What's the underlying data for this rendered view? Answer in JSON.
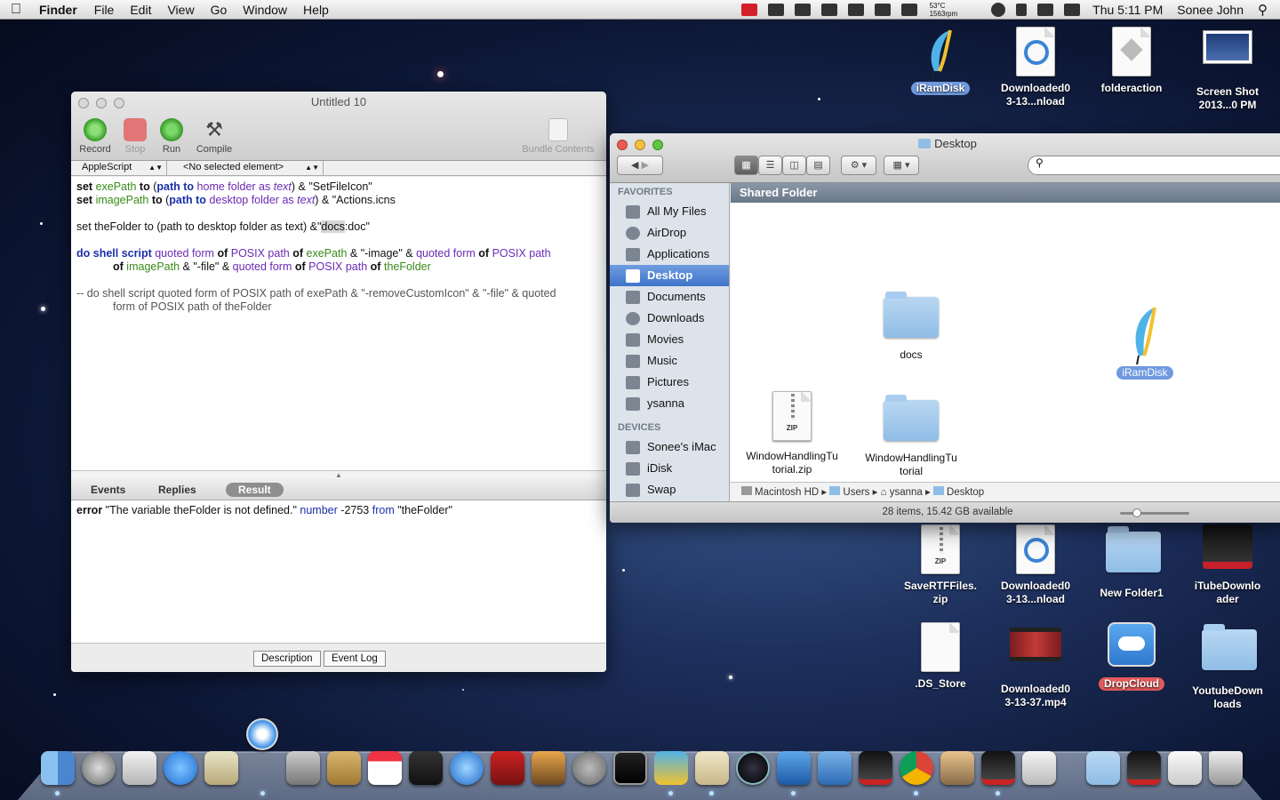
{
  "menubar": {
    "app_name": "Finder",
    "menus": [
      "File",
      "Edit",
      "View",
      "Go",
      "Window",
      "Help"
    ],
    "temp": "53°C",
    "rpm": "1563rpm",
    "clock": "Thu 5:11 PM",
    "user": "Sonee John"
  },
  "desktop_icons": {
    "iramdisk": "iRamDisk",
    "downloaded1": "Downloaded0 3-13...nload",
    "folderaction": "folderaction",
    "screenshot": "Screen Shot 2013...0 PM",
    "savertf": "SaveRTFFiles. zip",
    "downloaded2": "Downloaded0 3-13...nload",
    "newfolder": "New Folder1",
    "itube": "iTubeDownlo ader",
    "dsstore": ".DS_Store",
    "mp4": "Downloaded0 3-13-37.mp4",
    "dropcloud": "DropCloud",
    "youtube": "YoutubeDown loads"
  },
  "script_editor": {
    "title": "Untitled 10",
    "toolbar": {
      "record": "Record",
      "stop": "Stop",
      "run": "Run",
      "compile": "Compile",
      "bundle": "Bundle Contents"
    },
    "language": "AppleScript",
    "element": "<No selected element>",
    "code": {
      "l1": [
        "set",
        "exePath",
        "to",
        "(",
        "path to",
        "home folder",
        "as",
        "text",
        ") & \"SetFileIcon\""
      ],
      "l2": [
        "set",
        "imagePath",
        "to",
        "(",
        "path to",
        "desktop folder",
        "as",
        "text",
        ") & \"Actions.icns"
      ],
      "l3a": "set theFolder to (path to desktop folder as text) &\"",
      "l3b": "docs",
      "l3c": ":doc\"",
      "l4": [
        "do shell script",
        "quoted form",
        "of",
        "POSIX path",
        "of",
        "exePath",
        "& \"-image\" &",
        "quoted form",
        "of",
        "POSIX path"
      ],
      "l5": [
        "of",
        "imagePath",
        "& \"-file\" &",
        "quoted form",
        "of",
        "POSIX path",
        "of",
        "theFolder"
      ],
      "l6": "-- do shell script quoted form of POSIX path of exePath & \"-removeCustomIcon\" & \"-file\" & quoted",
      "l7": "form of POSIX path of theFolder"
    },
    "tabs": {
      "events": "Events",
      "replies": "Replies",
      "result": "Result"
    },
    "result": {
      "error_kw": "error",
      "message": "\"The variable theFolder is not defined.\"",
      "number_kw": "number",
      "code": "-2753",
      "from_kw": "from",
      "from_val": "\"theFolder\""
    },
    "bottom": {
      "description": "Description",
      "event_log": "Event Log"
    }
  },
  "finder": {
    "title": "Desktop",
    "sidebar": {
      "favorites_header": "FAVORITES",
      "favorites": [
        "All My Files",
        "AirDrop",
        "Applications",
        "Desktop",
        "Documents",
        "Downloads",
        "Movies",
        "Music",
        "Pictures",
        "ysanna"
      ],
      "devices_header": "DEVICES",
      "devices": [
        "Sonee's iMac",
        "iDisk",
        "Swap"
      ]
    },
    "header": "Shared Folder",
    "items": {
      "docs": "docs",
      "iramdisk": "iRamDisk",
      "zip": "WindowHandlingTu torial.zip",
      "folder": "WindowHandlingTu torial"
    },
    "path": [
      "Macintosh HD",
      "Users",
      "ysanna",
      "Desktop"
    ],
    "status": "28 items, 15.42 GB available"
  },
  "colors": {
    "accent": "#3f74c9",
    "selection": "#6f9ae0",
    "keyword_blue": "#1b2fa8",
    "variable_green": "#3a8a1a",
    "command_purple": "#6b2ab3"
  }
}
